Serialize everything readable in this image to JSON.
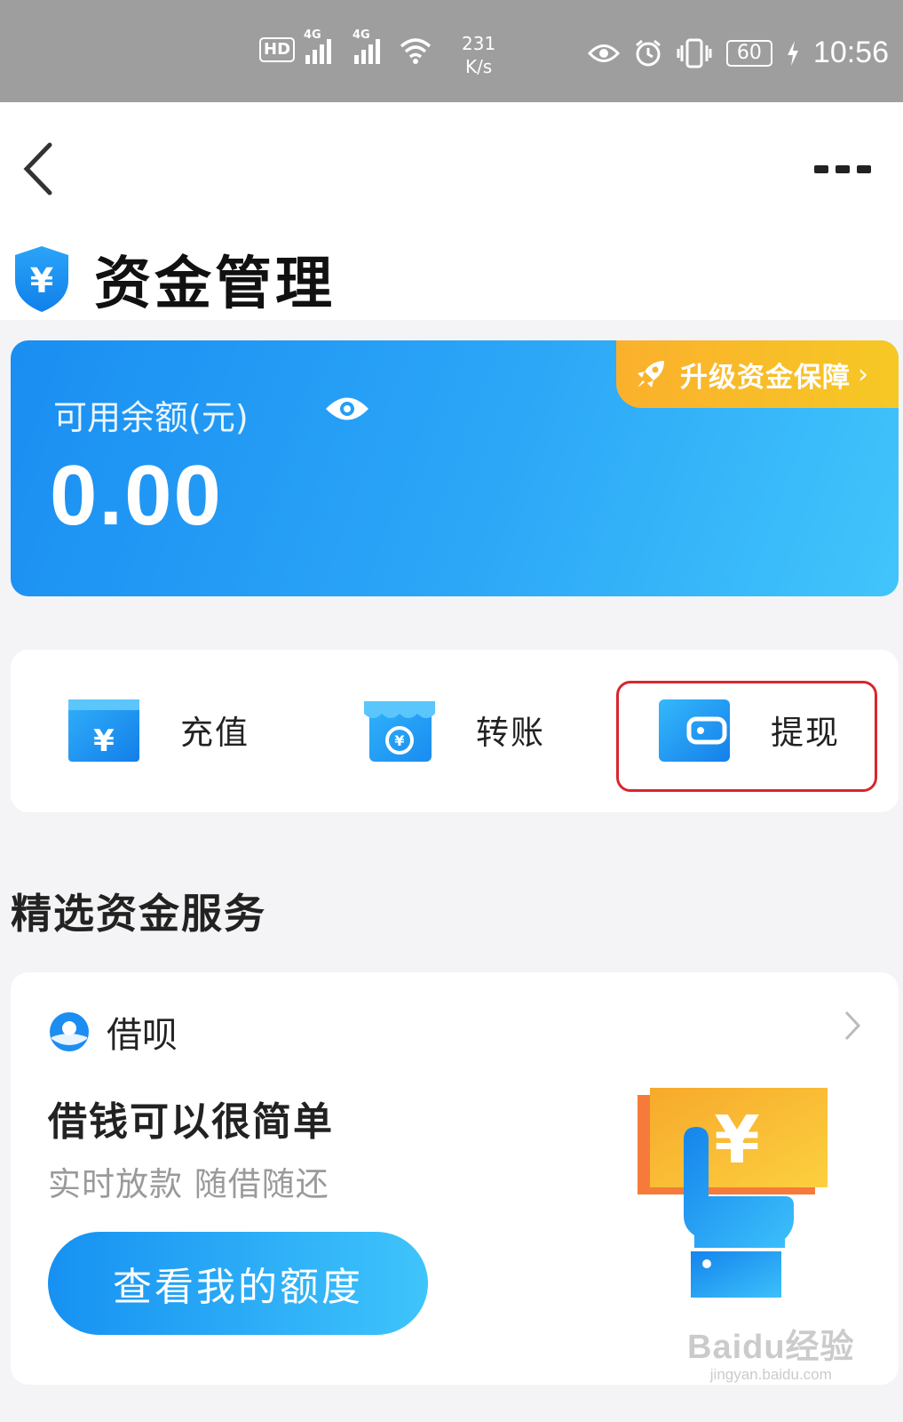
{
  "status_bar": {
    "hd_label": "HD",
    "sim1_label": "4G",
    "sim2_label": "4G",
    "net_speed_value": "231",
    "net_speed_unit": "K/s",
    "battery": "60",
    "time": "10:56"
  },
  "header": {
    "page_title": "资金管理"
  },
  "balance_card": {
    "label": "可用余额(元)",
    "value": "0.00",
    "upgrade_label": "升级资金保障",
    "upgrade_chevron": "›"
  },
  "actions": [
    {
      "label": "充值",
      "icon": "recharge-card-icon"
    },
    {
      "label": "转账",
      "icon": "transfer-store-icon"
    },
    {
      "label": "提现",
      "icon": "wallet-icon"
    }
  ],
  "section": {
    "title": "精选资金服务"
  },
  "loan_card": {
    "brand": "借呗",
    "headline": "借钱可以很简单",
    "subline": "实时放款 随借随还",
    "button_label": "查看我的额度"
  },
  "watermark": {
    "main": "Baidu经验",
    "url": "jingyan.baidu.com"
  },
  "colors": {
    "brand_blue": "#1a8ef2",
    "upgrade_orange": "#fbb02c",
    "highlight_red": "#d8262f"
  }
}
